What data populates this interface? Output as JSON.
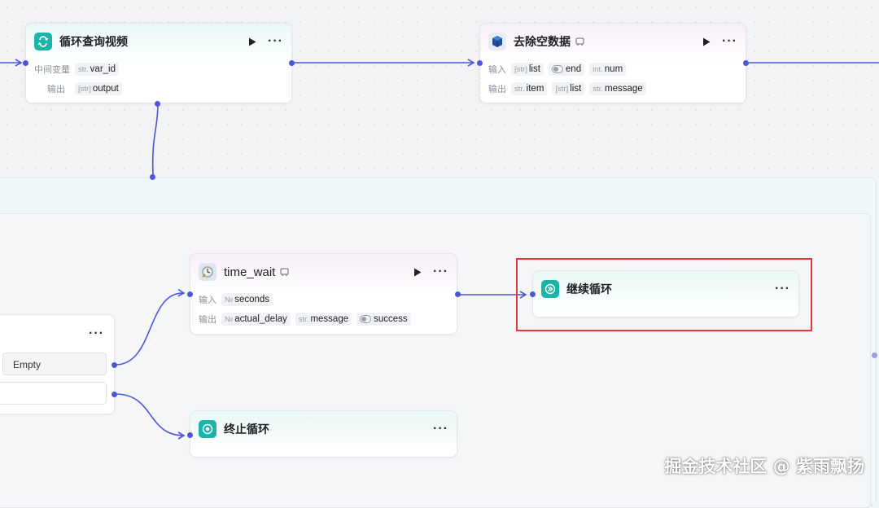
{
  "colors": {
    "edge": "#4e56d8",
    "highlight": "#e23b3b",
    "teal_icon": "#1cb3a9"
  },
  "nodes": {
    "loop_query": {
      "title": "循环查询视频",
      "icon": "loop-icon",
      "rows": [
        {
          "label": "中间变量",
          "tags": [
            {
              "type": "str.",
              "name": "var_id"
            }
          ]
        },
        {
          "label": "输出",
          "tags": [
            {
              "type": "[str]",
              "name": "output"
            }
          ]
        }
      ]
    },
    "remove_empty": {
      "title": "去除空数据",
      "icon": "python-cube-icon",
      "rows": [
        {
          "label": "输入",
          "tags": [
            {
              "type": "[str]",
              "name": "list"
            },
            {
              "type": "toggle",
              "name": "end"
            },
            {
              "type": "int.",
              "name": "num"
            }
          ]
        },
        {
          "label": "输出",
          "tags": [
            {
              "type": "str.",
              "name": "item"
            },
            {
              "type": "[str]",
              "name": "list"
            },
            {
              "type": "str.",
              "name": "message"
            }
          ]
        }
      ]
    },
    "time_wait": {
      "title": "time_wait",
      "icon": "timer-avatar-icon",
      "rows": [
        {
          "label": "输入",
          "tags": [
            {
              "type": "№",
              "name": "seconds"
            }
          ]
        },
        {
          "label": "输出",
          "tags": [
            {
              "type": "№",
              "name": "actual_delay"
            },
            {
              "type": "str.",
              "name": "message"
            },
            {
              "type": "toggle",
              "name": "success"
            }
          ]
        }
      ]
    },
    "continue_loop": {
      "title": "继续循环",
      "icon": "continue-icon"
    },
    "stop_loop": {
      "title": "终止循环",
      "icon": "stop-icon"
    },
    "condition": {
      "option1": "Empty"
    }
  },
  "more_label": "···",
  "watermark": "掘金技术社区 @ 紫雨飘扬"
}
